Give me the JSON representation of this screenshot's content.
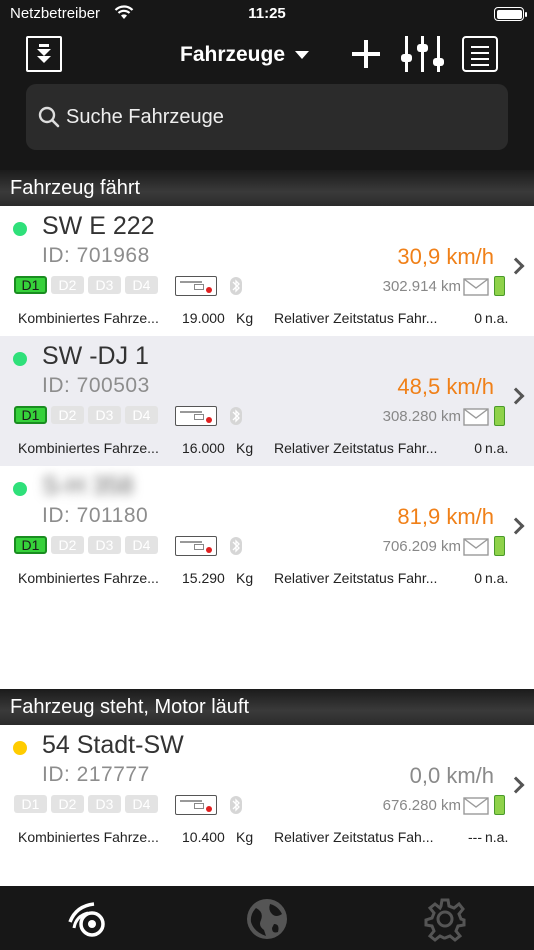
{
  "status_bar": {
    "carrier": "Netzbetreiber",
    "time": "11:25"
  },
  "nav": {
    "title": "Fahrzeuge",
    "search_placeholder": "Suche Fahrzeuge",
    "icons": [
      "filter-down-icon",
      "add-icon",
      "sliders-icon",
      "list-icon"
    ]
  },
  "sections": [
    {
      "title": "Fahrzeug fährt",
      "vehicles": [
        {
          "name": "SW E 222",
          "id": "ID: 701968",
          "speed": "30,9 km/h",
          "odometer": "302.914 km",
          "status_color": "#2fe07a",
          "active_driver": "D1",
          "weight_label": "Kombiniertes Fahrze...",
          "weight_value": "19.000",
          "weight_unit": "Kg",
          "time_label": "Relativer Zeitstatus Fahr...",
          "time_value": "0",
          "time_unit": "n.a."
        },
        {
          "name": "SW -DJ 1",
          "id": "ID: 700503",
          "speed": "48,5 km/h",
          "odometer": "308.280 km",
          "status_color": "#2fe07a",
          "active_driver": "D1",
          "weight_label": "Kombiniertes Fahrze...",
          "weight_value": "16.000",
          "weight_unit": "Kg",
          "time_label": "Relativer Zeitstatus Fahr...",
          "time_value": "0",
          "time_unit": "n.a."
        },
        {
          "name": "S-H 358",
          "id": "ID: 701180",
          "speed": "81,9 km/h",
          "odometer": "706.209 km",
          "status_color": "#2fe07a",
          "active_driver": "D1",
          "weight_label": "Kombiniertes Fahrze...",
          "weight_value": "15.290",
          "weight_unit": "Kg",
          "time_label": "Relativer Zeitstatus Fahr...",
          "time_value": "0",
          "time_unit": "n.a."
        }
      ]
    },
    {
      "title": "Fahrzeug steht, Motor läuft",
      "vehicles": [
        {
          "name": "54 Stadt-SW",
          "id": "ID: 217777",
          "speed": "0,0 km/h",
          "odometer": "676.280 km",
          "status_color": "#ffcc00",
          "active_driver": "",
          "weight_label": "Kombiniertes Fahrze...",
          "weight_value": "10.400",
          "weight_unit": "Kg",
          "time_label": "Relativer Zeitstatus Fah...",
          "time_value": "---",
          "time_unit": "n.a."
        }
      ]
    }
  ],
  "drivers": [
    "D1",
    "D2",
    "D3",
    "D4"
  ],
  "tabbar": [
    "vehicles-tab-icon",
    "globe-tab-icon",
    "settings-tab-icon"
  ]
}
